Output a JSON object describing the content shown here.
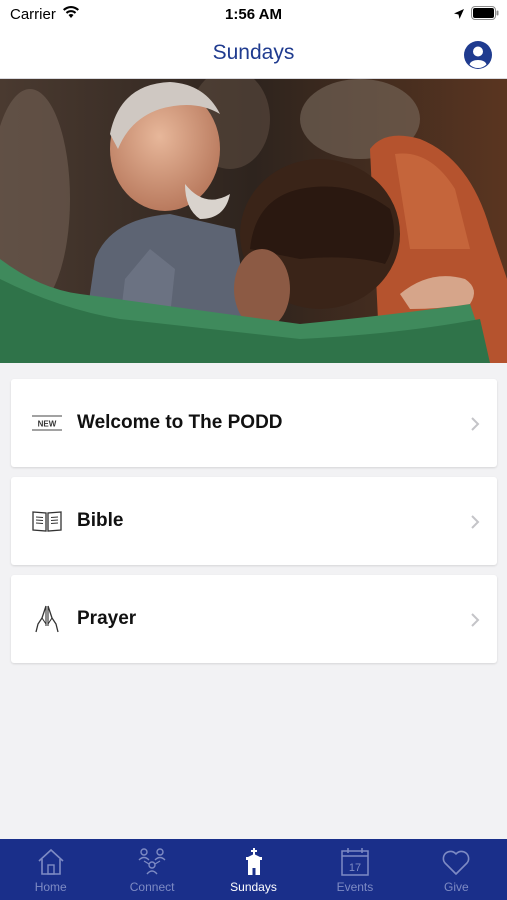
{
  "status_bar": {
    "carrier": "Carrier",
    "time": "1:56 AM"
  },
  "nav": {
    "title": "Sundays"
  },
  "menu": {
    "items": [
      {
        "label": "Welcome to The PODD",
        "icon": "new-badge-icon",
        "badge_text": "NEW"
      },
      {
        "label": "Bible",
        "icon": "bible-icon"
      },
      {
        "label": "Prayer",
        "icon": "praying-hands-icon"
      }
    ]
  },
  "tabs": {
    "items": [
      {
        "label": "Home",
        "icon": "home-icon",
        "active": false
      },
      {
        "label": "Connect",
        "icon": "connect-icon",
        "active": false
      },
      {
        "label": "Sundays",
        "icon": "church-icon",
        "active": true
      },
      {
        "label": "Events",
        "icon": "calendar-icon",
        "active": false,
        "calendar_day": "17"
      },
      {
        "label": "Give",
        "icon": "heart-icon",
        "active": false
      }
    ]
  },
  "colors": {
    "accent": "#1f3b8f",
    "tab_bar_bg": "#1a2f8a",
    "tab_inactive": "#7e8bc4",
    "tab_active": "#ffffff"
  }
}
